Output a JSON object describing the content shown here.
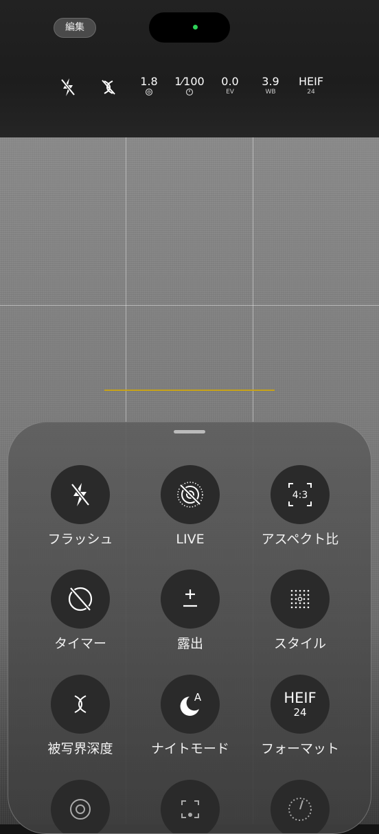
{
  "top": {
    "edit_label": "編集",
    "indicator_color": "#2ed158"
  },
  "status_bar": [
    {
      "id": "flash",
      "icon": "flash-off-icon",
      "value": "",
      "sub": ""
    },
    {
      "id": "dof",
      "icon": "depth-of-field-off-icon",
      "value": "",
      "sub": ""
    },
    {
      "id": "aperture",
      "value": "1.8",
      "sub_icon": "aperture-icon"
    },
    {
      "id": "shutter",
      "value": "1⁄100",
      "sub_icon": "timer-icon"
    },
    {
      "id": "ev",
      "value": "0.0",
      "sub": "EV"
    },
    {
      "id": "wb",
      "value": "3.9",
      "sub": "WB"
    },
    {
      "id": "format",
      "value": "HEIF",
      "sub": "24"
    }
  ],
  "controls": [
    {
      "id": "flash",
      "label": "フラッシュ",
      "icon": "flash-off-icon"
    },
    {
      "id": "live",
      "label": "LIVE",
      "icon": "live-off-icon"
    },
    {
      "id": "aspect",
      "label": "アスペクト比",
      "icon": "aspect-ratio-icon",
      "icon_text": "4:3"
    },
    {
      "id": "timer",
      "label": "タイマー",
      "icon": "timer-off-icon"
    },
    {
      "id": "exposure",
      "label": "露出",
      "icon": "exposure-icon",
      "icon_text": "±"
    },
    {
      "id": "style",
      "label": "スタイル",
      "icon": "style-grid-icon"
    },
    {
      "id": "dof",
      "label": "被写界深度",
      "icon": "depth-of-field-icon"
    },
    {
      "id": "night",
      "label": "ナイトモード",
      "icon": "night-mode-icon",
      "icon_text": "A"
    },
    {
      "id": "format",
      "label": "フォーマット",
      "icon": "format-icon",
      "icon_text": "HEIF",
      "icon_sub": "24"
    }
  ],
  "colors": {
    "level_line": "#c9a418",
    "circle_bg": "#2a2a2a"
  }
}
